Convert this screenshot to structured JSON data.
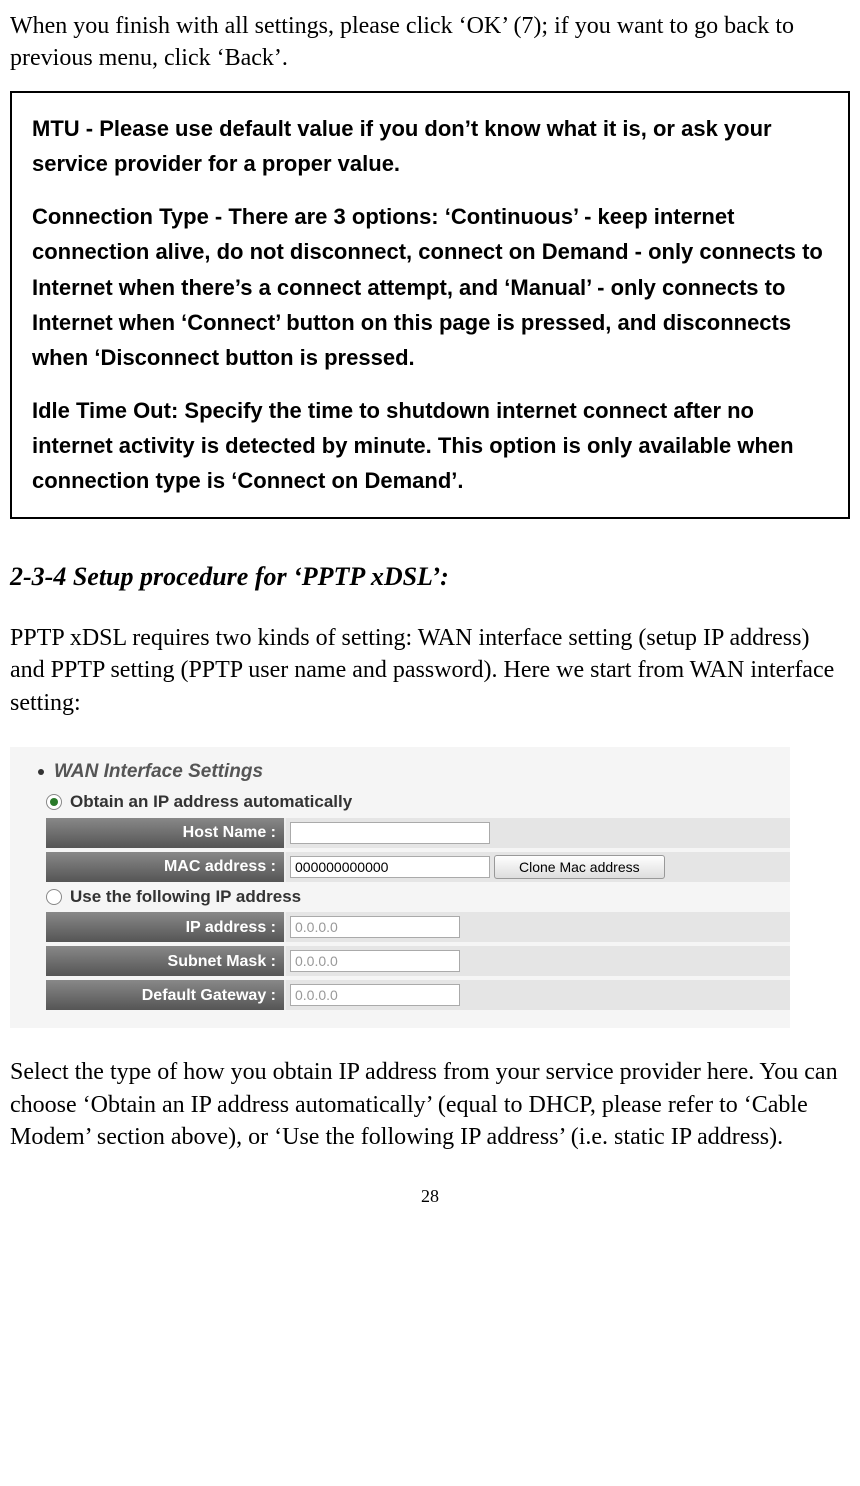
{
  "intro": "When you finish with all settings, please click ‘OK’ (7); if you want to go back to previous menu, click ‘Back’.",
  "box": {
    "p1": "MTU - Please use default value if you don’t know what it is, or ask your service provider for a proper value.",
    "p2": "Connection Type - There are 3 options: ‘Continuous’ - keep internet connection alive, do not disconnect, connect on Demand - only connects to Internet when there’s a connect attempt, and ‘Manual’ - only connects to Internet when ‘Connect’ button on this page is pressed, and disconnects when ‘Disconnect button is pressed.",
    "p3": "Idle Time Out: Specify the time to shutdown internet connect after no internet activity is detected by minute. This option is only available when connection type is ‘Connect on Demand’."
  },
  "section_heading": "2-3-4 Setup procedure for ‘PPTP xDSL’:",
  "section_intro": "PPTP xDSL requires two kinds of setting: WAN interface setting (setup IP address) and PPTP setting (PPTP user name and password). Here we start from WAN interface setting:",
  "panel": {
    "title": "WAN Interface Settings",
    "opt_auto": "Obtain an IP address automatically",
    "opt_manual": "Use the following IP address",
    "host_name_label": "Host Name :",
    "host_name_value": "",
    "mac_label": "MAC address :",
    "mac_value": "000000000000",
    "clone_btn": "Clone Mac address",
    "ip_label": "IP address :",
    "ip_value": "0.0.0.0",
    "subnet_label": "Subnet Mask :",
    "subnet_value": "0.0.0.0",
    "gateway_label": "Default Gateway :",
    "gateway_value": "0.0.0.0"
  },
  "section_after": "Select the type of how you obtain IP address from your service provider here. You can choose ‘Obtain an IP address automatically’ (equal to DHCP, please refer to ‘Cable Modem’ section above), or ‘Use the following IP address’ (i.e. static IP address).",
  "page_number": "28"
}
